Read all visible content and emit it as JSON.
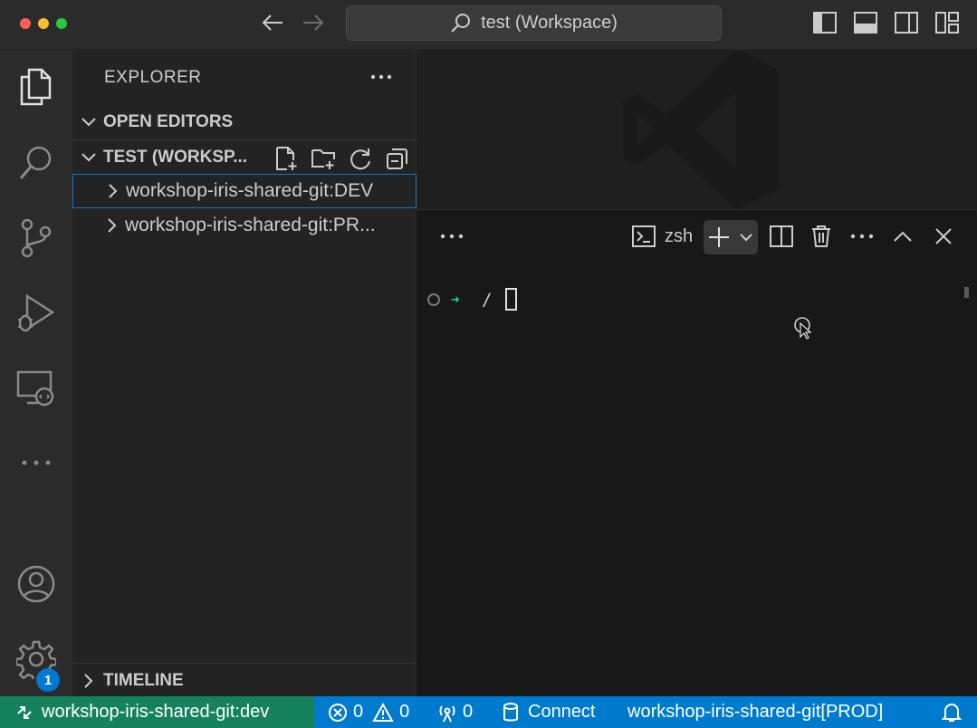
{
  "window": {
    "title": "test (Workspace)"
  },
  "sidebar": {
    "title": "EXPLORER",
    "sections": {
      "open_editors": "OPEN EDITORS",
      "workspace": "TEST (WORKSP...",
      "timeline": "TIMELINE"
    },
    "tree": [
      {
        "label": "workshop-iris-shared-git:DEV"
      },
      {
        "label": "workshop-iris-shared-git:PR..."
      }
    ]
  },
  "activity": {
    "settings_badge": "1"
  },
  "panel": {
    "terminal_name": "zsh",
    "prompt_path": "/"
  },
  "statusbar": {
    "remote": "workshop-iris-shared-git:dev",
    "errors": "0",
    "warnings": "0",
    "ports": "0",
    "connect": "Connect",
    "server": "workshop-iris-shared-git[PROD]"
  },
  "colors": {
    "status_bg": "#007acc",
    "remote_bg": "#16825d",
    "badge": "#0078d4",
    "prompt_arrow": "#23d18b"
  }
}
